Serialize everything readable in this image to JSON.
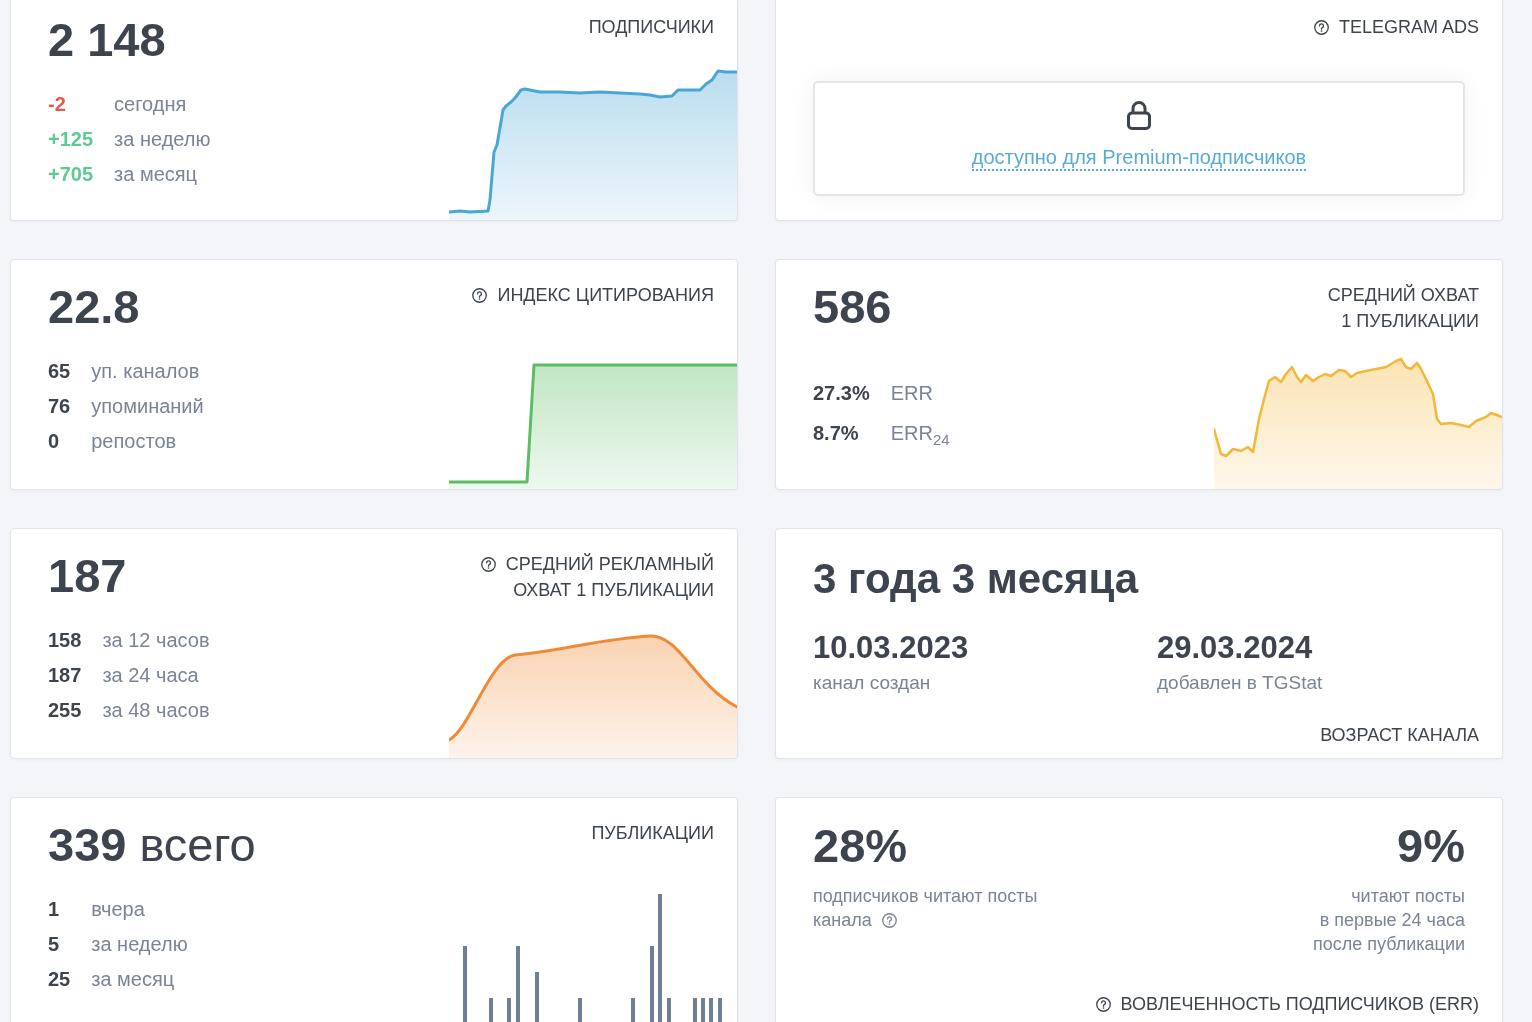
{
  "cards": [
    {
      "kind": "metric",
      "title": "ПОДПИСЧИКИ",
      "help": false,
      "value": "2 148",
      "rows": [
        {
          "value": "-2",
          "label": "сегодня",
          "color": "#e8574d"
        },
        {
          "value": "+125",
          "label": "за неделю",
          "color": "#5ccb91"
        },
        {
          "value": "+705",
          "label": "за месяц",
          "color": "#5ccb91"
        }
      ],
      "sparkline": {
        "kind": "area",
        "color": "#4aa6d6"
      }
    },
    {
      "kind": "locked",
      "title": "TELEGRAM ADS",
      "help": true,
      "link": "доступно для Premium-подписчиков"
    },
    {
      "kind": "metric",
      "title": "ИНДЕКС ЦИТИРОВАНИЯ",
      "help": true,
      "value": "22.8",
      "rows": [
        {
          "value": "65",
          "label": "уп. каналов"
        },
        {
          "value": "76",
          "label": "упоминаний"
        },
        {
          "value": "0",
          "label": "репостов"
        }
      ],
      "sparkline": {
        "kind": "area",
        "color": "#5cbd62"
      }
    },
    {
      "kind": "metric",
      "title": "СРЕДНИЙ ОХВАТ\n1 ПУБЛИКАЦИИ",
      "help": false,
      "value": "586",
      "rows": [
        {
          "value": "27.3%",
          "label": "ERR"
        },
        {
          "value": "8.7%",
          "label": "ERR$_{24}$"
        }
      ],
      "sparkline": {
        "kind": "area",
        "color": "#f4b73a"
      }
    },
    {
      "kind": "metric",
      "title": "СРЕДНИЙ РЕКЛАМНЫЙ\nОХВАТ 1 ПУБЛИКАЦИИ",
      "help": true,
      "value": "187",
      "rows": [
        {
          "value": "158",
          "label": "за 12 часов"
        },
        {
          "value": "187",
          "label": "за 24 часа"
        },
        {
          "value": "255",
          "label": "за 48 часов"
        }
      ],
      "sparkline": {
        "kind": "area",
        "color": "#f08a35"
      }
    },
    {
      "kind": "age",
      "title": "ВОЗРАСТ КАНАЛА",
      "help": false,
      "value": "3 года 3 месяца",
      "dates": [
        {
          "value": "10.03.2023",
          "label": "канал создан"
        },
        {
          "value": "29.03.2024",
          "label": "добавлен в TGStat"
        }
      ]
    },
    {
      "kind": "metric",
      "title": "ПУБЛИКАЦИИ",
      "help": false,
      "value": "339",
      "unit": "всего",
      "rows": [
        {
          "value": "1",
          "label": "вчера"
        },
        {
          "value": "5",
          "label": "за неделю"
        },
        {
          "value": "25",
          "label": "за месяц"
        }
      ],
      "sparkline": {
        "kind": "bars",
        "color": "#6e7f96"
      }
    },
    {
      "kind": "engagement",
      "title": "ВОВЛЕЧЕННОСТЬ ПОДПИСЧИКОВ (ERR)",
      "help": true,
      "figures": [
        {
          "value": "28%",
          "lines": [
            "подписчиков читают посты",
            "канала"
          ],
          "help": true
        },
        {
          "value": "9%",
          "lines": [
            "читают посты",
            "в первые 24 часа",
            "после публикации"
          ],
          "help": false
        }
      ]
    }
  ]
}
